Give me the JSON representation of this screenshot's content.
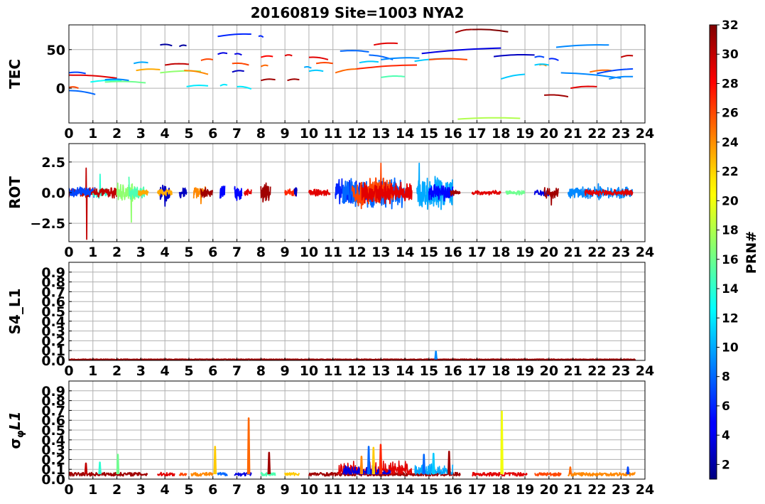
{
  "title": "20160819 Site=1003 NYA2",
  "colorbar": {
    "label": "PRN#",
    "min": 1,
    "max": 32,
    "ticks": [
      2,
      4,
      6,
      8,
      10,
      12,
      14,
      16,
      18,
      20,
      22,
      24,
      26,
      28,
      30,
      32
    ]
  },
  "chart_data": [
    {
      "type": "line",
      "ylabel": "TEC",
      "xlim": [
        0,
        24
      ],
      "ylim": [
        -45,
        82
      ],
      "xticks": [
        0,
        1,
        2,
        3,
        4,
        5,
        6,
        7,
        8,
        9,
        10,
        11,
        12,
        13,
        14,
        15,
        16,
        17,
        18,
        19,
        20,
        21,
        22,
        23,
        24
      ],
      "yticks": [
        0,
        50
      ],
      "grid": true,
      "series": [
        {
          "prn": 7,
          "x": [
            0.0,
            0.7
          ],
          "y": [
            20,
            19
          ]
        },
        {
          "prn": 8,
          "x": [
            0.0,
            1.1
          ],
          "y": [
            -3,
            -8
          ]
        },
        {
          "prn": 29,
          "x": [
            0.0,
            1.2,
            2.0
          ],
          "y": [
            17,
            17,
            13
          ]
        },
        {
          "prn": 26,
          "x": [
            0.0,
            0.4
          ],
          "y": [
            1,
            0
          ]
        },
        {
          "prn": 13,
          "x": [
            0.9,
            2.2
          ],
          "y": [
            8,
            10
          ]
        },
        {
          "prn": 16,
          "x": [
            1.5,
            3.2
          ],
          "y": [
            8,
            7
          ]
        },
        {
          "prn": 9,
          "x": [
            1.5,
            2.5
          ],
          "y": [
            11,
            10
          ]
        },
        {
          "prn": 10,
          "x": [
            2.7,
            3.3
          ],
          "y": [
            32,
            33
          ]
        },
        {
          "prn": 23,
          "x": [
            2.8,
            3.8
          ],
          "y": [
            23,
            24
          ]
        },
        {
          "prn": 2,
          "x": [
            3.8,
            4.3
          ],
          "y": [
            56,
            55
          ]
        },
        {
          "prn": 2,
          "x": [
            4.6,
            4.9
          ],
          "y": [
            54,
            55
          ]
        },
        {
          "prn": 17,
          "x": [
            3.8,
            5.5
          ],
          "y": [
            20,
            22
          ]
        },
        {
          "prn": 24,
          "x": [
            4.8,
            5.8
          ],
          "y": [
            23,
            18
          ]
        },
        {
          "prn": 30,
          "x": [
            4.0,
            5.0
          ],
          "y": [
            30,
            31
          ]
        },
        {
          "prn": 12,
          "x": [
            4.9,
            5.8
          ],
          "y": [
            2,
            3
          ]
        },
        {
          "prn": 26,
          "x": [
            5.5,
            6.0
          ],
          "y": [
            36,
            37
          ]
        },
        {
          "prn": 6,
          "x": [
            6.2,
            7.6
          ],
          "y": [
            67,
            70
          ]
        },
        {
          "prn": 6,
          "x": [
            7.9,
            8.1
          ],
          "y": [
            67,
            66
          ]
        },
        {
          "prn": 4,
          "x": [
            6.2,
            6.6
          ],
          "y": [
            44,
            45
          ]
        },
        {
          "prn": 4,
          "x": [
            6.9,
            7.2
          ],
          "y": [
            44,
            43
          ]
        },
        {
          "prn": 12,
          "x": [
            6.3,
            6.6
          ],
          "y": [
            3,
            4
          ]
        },
        {
          "prn": 12,
          "x": [
            7.0,
            7.6
          ],
          "y": [
            2,
            -1
          ]
        },
        {
          "prn": 26,
          "x": [
            6.8,
            7.5
          ],
          "y": [
            32,
            30
          ]
        },
        {
          "prn": 3,
          "x": [
            6.8,
            7.3
          ],
          "y": [
            21,
            22
          ]
        },
        {
          "prn": 28,
          "x": [
            8.0,
            8.5
          ],
          "y": [
            40,
            41
          ]
        },
        {
          "prn": 25,
          "x": [
            8.0,
            8.3
          ],
          "y": [
            28,
            29
          ]
        },
        {
          "prn": 31,
          "x": [
            8.0,
            8.6
          ],
          "y": [
            10,
            11
          ]
        },
        {
          "prn": 29,
          "x": [
            9.0,
            9.3
          ],
          "y": [
            42,
            42
          ]
        },
        {
          "prn": 31,
          "x": [
            9.1,
            9.6
          ],
          "y": [
            10,
            11
          ]
        },
        {
          "prn": 29,
          "x": [
            10.0,
            10.8
          ],
          "y": [
            40,
            37
          ]
        },
        {
          "prn": 26,
          "x": [
            10.3,
            11.0
          ],
          "y": [
            32,
            32
          ]
        },
        {
          "prn": 11,
          "x": [
            10.0,
            10.6
          ],
          "y": [
            22,
            22
          ]
        },
        {
          "prn": 10,
          "x": [
            9.8,
            10.1
          ],
          "y": [
            27,
            26
          ]
        },
        {
          "prn": 8,
          "x": [
            11.3,
            12.5
          ],
          "y": [
            48,
            47
          ]
        },
        {
          "prn": 8,
          "x": [
            12.5,
            13.5
          ],
          "y": [
            43,
            37
          ]
        },
        {
          "prn": 25,
          "x": [
            11.1,
            12.0
          ],
          "y": [
            20,
            25
          ]
        },
        {
          "prn": 27,
          "x": [
            12.0,
            14.5
          ],
          "y": [
            25,
            30
          ]
        },
        {
          "prn": 11,
          "x": [
            12.1,
            12.9
          ],
          "y": [
            33,
            34
          ]
        },
        {
          "prn": 29,
          "x": [
            12.7,
            13.7
          ],
          "y": [
            56,
            58
          ]
        },
        {
          "prn": 9,
          "x": [
            13.0,
            14.6
          ],
          "y": [
            37,
            39
          ]
        },
        {
          "prn": 15,
          "x": [
            13.0,
            14.0
          ],
          "y": [
            14,
            15
          ]
        },
        {
          "prn": 11,
          "x": [
            14.4,
            16.0
          ],
          "y": [
            35,
            38
          ]
        },
        {
          "prn": 26,
          "x": [
            15.0,
            16.6
          ],
          "y": [
            37,
            37
          ]
        },
        {
          "prn": 4,
          "x": [
            14.7,
            18.0
          ],
          "y": [
            45,
            52
          ]
        },
        {
          "prn": 31,
          "x": [
            16.1,
            16.8
          ],
          "y": [
            72,
            76
          ]
        },
        {
          "prn": 32,
          "x": [
            16.8,
            18.3
          ],
          "y": [
            76,
            73
          ]
        },
        {
          "prn": 18,
          "x": [
            16.2,
            18.8
          ],
          "y": [
            -40,
            -39
          ]
        },
        {
          "prn": 3,
          "x": [
            17.7,
            19.4
          ],
          "y": [
            41,
            43
          ]
        },
        {
          "prn": 11,
          "x": [
            18.0,
            19.0
          ],
          "y": [
            12,
            18
          ]
        },
        {
          "prn": 24,
          "x": [
            19.6,
            19.9
          ],
          "y": [
            30,
            29
          ]
        },
        {
          "prn": 7,
          "x": [
            19.4,
            19.8
          ],
          "y": [
            40,
            40
          ]
        },
        {
          "prn": 11,
          "x": [
            19.4,
            20.0
          ],
          "y": [
            30,
            30
          ]
        },
        {
          "prn": 6,
          "x": [
            20.0,
            20.4
          ],
          "y": [
            38,
            36
          ]
        },
        {
          "prn": 31,
          "x": [
            19.8,
            20.8
          ],
          "y": [
            -9,
            -11
          ]
        },
        {
          "prn": 9,
          "x": [
            20.3,
            22.5
          ],
          "y": [
            53,
            56
          ]
        },
        {
          "prn": 9,
          "x": [
            20.5,
            23.0
          ],
          "y": [
            20,
            13
          ]
        },
        {
          "prn": 29,
          "x": [
            20.9,
            22.0
          ],
          "y": [
            0,
            2
          ]
        },
        {
          "prn": 25,
          "x": [
            21.7,
            22.6
          ],
          "y": [
            21,
            23
          ]
        },
        {
          "prn": 7,
          "x": [
            22.0,
            23.5
          ],
          "y": [
            19,
            25
          ]
        },
        {
          "prn": 9,
          "x": [
            22.5,
            23.5
          ],
          "y": [
            12,
            15
          ]
        },
        {
          "prn": 30,
          "x": [
            23.0,
            23.5
          ],
          "y": [
            40,
            42
          ]
        }
      ]
    },
    {
      "type": "line",
      "ylabel": "ROT",
      "xlim": [
        0,
        24
      ],
      "ylim": [
        -4,
        4
      ],
      "xticks": [
        0,
        1,
        2,
        3,
        4,
        5,
        6,
        7,
        8,
        9,
        10,
        11,
        12,
        13,
        14,
        15,
        16,
        17,
        18,
        19,
        20,
        21,
        22,
        23,
        24
      ],
      "yticks": [
        -2.5,
        0.0,
        2.5
      ],
      "ytick_labels": [
        "−2.5",
        "0.0",
        "2.5"
      ],
      "grid": true,
      "segments": [
        {
          "prn": 30,
          "x0": 0.0,
          "x1": 1.2,
          "amp": 0.4,
          "spike": {
            "x": 0.75,
            "y": -3.8
          },
          "spike2": {
            "x": 0.72,
            "y": 2.0
          }
        },
        {
          "prn": 7,
          "x0": 0.0,
          "x1": 1.1,
          "amp": 0.5
        },
        {
          "prn": 14,
          "x0": 1.0,
          "x1": 1.6,
          "amp": 0.5,
          "spike": {
            "x": 1.3,
            "y": 1.5
          }
        },
        {
          "prn": 30,
          "x0": 1.0,
          "x1": 2.0,
          "amp": 0.5
        },
        {
          "prn": 17,
          "x0": 2.0,
          "x1": 2.8,
          "amp": 0.9,
          "spike": {
            "x": 2.6,
            "y": -2.4
          }
        },
        {
          "prn": 15,
          "x0": 2.5,
          "x1": 3.2,
          "amp": 0.6,
          "spike": {
            "x": 2.5,
            "y": 1.3
          }
        },
        {
          "prn": 23,
          "x0": 2.9,
          "x1": 3.3,
          "amp": 0.3
        },
        {
          "prn": 3,
          "x0": 3.8,
          "x1": 4.2,
          "amp": 0.8,
          "spike": {
            "x": 4.0,
            "y": -1.1
          }
        },
        {
          "prn": 23,
          "x0": 3.7,
          "x1": 4.3,
          "amp": 0.3
        },
        {
          "prn": 3,
          "x0": 4.6,
          "x1": 4.9,
          "amp": 0.6
        },
        {
          "prn": 24,
          "x0": 5.2,
          "x1": 5.7,
          "amp": 0.6,
          "spike": {
            "x": 5.5,
            "y": -0.9
          }
        },
        {
          "prn": 31,
          "x0": 5.5,
          "x1": 6.0,
          "amp": 0.4
        },
        {
          "prn": 5,
          "x0": 6.3,
          "x1": 6.5,
          "amp": 0.6
        },
        {
          "prn": 5,
          "x0": 6.9,
          "x1": 7.2,
          "amp": 0.8
        },
        {
          "prn": 29,
          "x0": 7.3,
          "x1": 7.6,
          "amp": 0.3
        },
        {
          "prn": 31,
          "x0": 8.0,
          "x1": 8.4,
          "amp": 0.9
        },
        {
          "prn": 27,
          "x0": 9.0,
          "x1": 9.5,
          "amp": 0.4
        },
        {
          "prn": 3,
          "x0": 9.4,
          "x1": 9.5,
          "amp": 0.5
        },
        {
          "prn": 29,
          "x0": 10.0,
          "x1": 10.9,
          "amp": 0.3
        },
        {
          "prn": 6,
          "x0": 11.1,
          "x1": 12.5,
          "amp": 1.2
        },
        {
          "prn": 8,
          "x0": 11.4,
          "x1": 14.0,
          "amp": 1.4
        },
        {
          "prn": 26,
          "x0": 11.8,
          "x1": 13.5,
          "amp": 1.4,
          "spike": {
            "x": 13.0,
            "y": 2.4
          }
        },
        {
          "prn": 29,
          "x0": 12.2,
          "x1": 14.3,
          "amp": 1.0
        },
        {
          "prn": 10,
          "x0": 14.5,
          "x1": 16.0,
          "amp": 1.6,
          "spike": {
            "x": 14.6,
            "y": 2.4
          }
        },
        {
          "prn": 5,
          "x0": 15.0,
          "x1": 16.0,
          "amp": 0.7
        },
        {
          "prn": 31,
          "x0": 15.9,
          "x1": 16.3,
          "amp": 0.3
        },
        {
          "prn": 29,
          "x0": 16.8,
          "x1": 18.0,
          "amp": 0.2
        },
        {
          "prn": 16,
          "x0": 18.2,
          "x1": 19.0,
          "amp": 0.2
        },
        {
          "prn": 4,
          "x0": 19.4,
          "x1": 20.0,
          "amp": 0.3
        },
        {
          "prn": 31,
          "x0": 19.8,
          "x1": 20.4,
          "amp": 0.5,
          "spike": {
            "x": 20.1,
            "y": -1.0
          }
        },
        {
          "prn": 9,
          "x0": 20.8,
          "x1": 23.5,
          "amp": 0.5
        },
        {
          "prn": 9,
          "x0": 22.0,
          "x1": 22.2,
          "amp": 0.9
        },
        {
          "prn": 29,
          "x0": 21.5,
          "x1": 23.5,
          "amp": 0.3
        }
      ]
    },
    {
      "type": "line",
      "ylabel": "S4_L1",
      "xlim": [
        0,
        24
      ],
      "ylim": [
        0,
        1
      ],
      "xticks": [
        0,
        1,
        2,
        3,
        4,
        5,
        6,
        7,
        8,
        9,
        10,
        11,
        12,
        13,
        14,
        15,
        16,
        17,
        18,
        19,
        20,
        21,
        22,
        23,
        24
      ],
      "yticks": [
        0.0,
        0.1,
        0.2,
        0.3,
        0.4,
        0.5,
        0.6,
        0.7,
        0.8,
        0.9
      ],
      "grid": true,
      "baseline": 0.01,
      "spikes": [
        {
          "prn": 9,
          "x": 15.3,
          "y": 0.09
        }
      ]
    },
    {
      "type": "line",
      "ylabel": "σ_φL1",
      "xlim": [
        0,
        24
      ],
      "ylim": [
        0,
        1
      ],
      "xticks": [
        0,
        1,
        2,
        3,
        4,
        5,
        6,
        7,
        8,
        9,
        10,
        11,
        12,
        13,
        14,
        15,
        16,
        17,
        18,
        19,
        20,
        21,
        22,
        23,
        24
      ],
      "yticks": [
        0.0,
        0.1,
        0.2,
        0.3,
        0.4,
        0.5,
        0.6,
        0.7,
        0.8,
        0.9
      ],
      "grid": true,
      "baseline": 0.05,
      "spikes": [
        {
          "prn": 30,
          "x": 0.72,
          "y": 0.16
        },
        {
          "prn": 14,
          "x": 1.3,
          "y": 0.17
        },
        {
          "prn": 16,
          "x": 2.05,
          "y": 0.25
        },
        {
          "prn": 22,
          "x": 6.1,
          "y": 0.33
        },
        {
          "prn": 25,
          "x": 7.5,
          "y": 0.62
        },
        {
          "prn": 31,
          "x": 8.35,
          "y": 0.27
        },
        {
          "prn": 8,
          "x": 12.5,
          "y": 0.33
        },
        {
          "prn": 22,
          "x": 12.7,
          "y": 0.32
        },
        {
          "prn": 27,
          "x": 13.0,
          "y": 0.35
        },
        {
          "prn": 24,
          "x": 12.2,
          "y": 0.23
        },
        {
          "prn": 8,
          "x": 14.8,
          "y": 0.25
        },
        {
          "prn": 11,
          "x": 15.2,
          "y": 0.26
        },
        {
          "prn": 31,
          "x": 15.85,
          "y": 0.28
        },
        {
          "prn": 20,
          "x": 18.05,
          "y": 0.69
        },
        {
          "prn": 25,
          "x": 20.9,
          "y": 0.12
        },
        {
          "prn": 7,
          "x": 23.3,
          "y": 0.12
        }
      ],
      "bursts": [
        {
          "prn": 29,
          "x0": 11.2,
          "x1": 14.3,
          "amp": 0.15
        },
        {
          "prn": 10,
          "x0": 14.4,
          "x1": 16.0,
          "amp": 0.12
        },
        {
          "prn": 4,
          "x0": 11.4,
          "x1": 13.4,
          "amp": 0.1
        }
      ],
      "coverage": [
        [
          0.0,
          3.3
        ],
        [
          3.7,
          4.4
        ],
        [
          4.6,
          4.9
        ],
        [
          5.1,
          6.0
        ],
        [
          6.2,
          6.6
        ],
        [
          6.9,
          7.6
        ],
        [
          8.0,
          8.6
        ],
        [
          9.0,
          9.6
        ],
        [
          10.0,
          16.3
        ],
        [
          16.8,
          19.1
        ],
        [
          19.4,
          20.5
        ],
        [
          20.8,
          23.6
        ]
      ]
    }
  ]
}
